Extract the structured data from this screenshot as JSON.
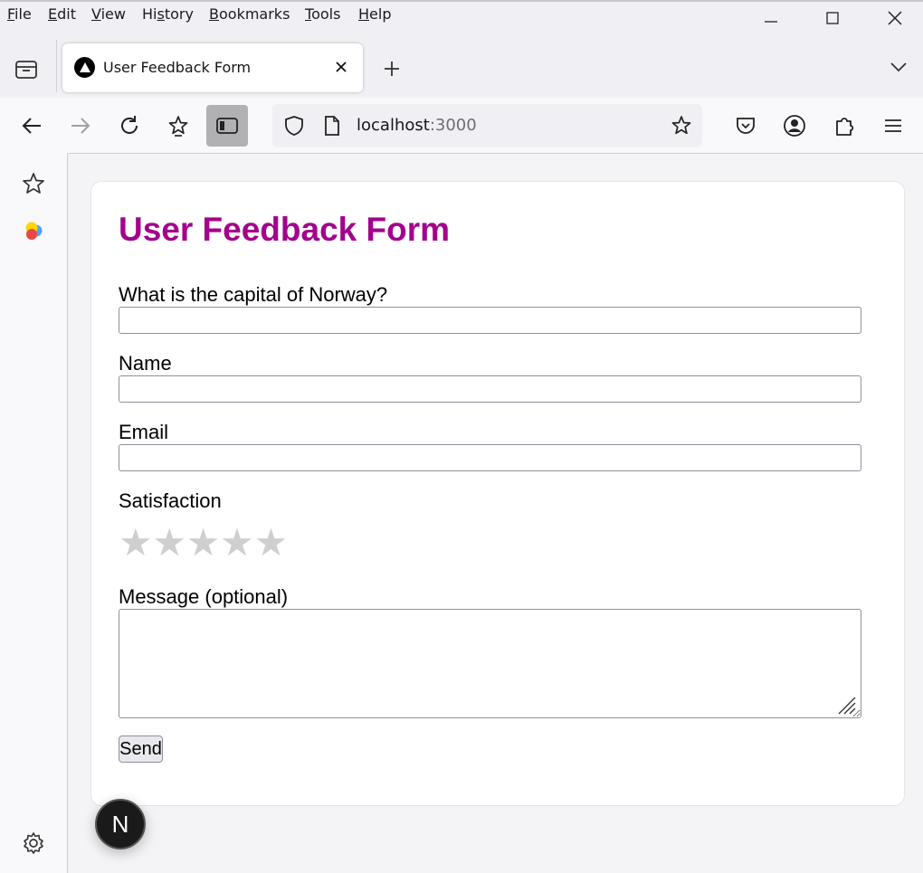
{
  "menu": {
    "file": {
      "accel": "F",
      "rest": "ile"
    },
    "edit": {
      "accel": "E",
      "rest": "dit"
    },
    "view": {
      "accel": "V",
      "rest": "iew"
    },
    "history": {
      "pre": "Hi",
      "accel": "s",
      "rest": "tory"
    },
    "bookmarks": {
      "accel": "B",
      "rest": "ookmarks"
    },
    "tools": {
      "accel": "T",
      "rest": "ools"
    },
    "help": {
      "accel": "H",
      "rest": "elp"
    }
  },
  "tab": {
    "title": "User Feedback Form"
  },
  "urlbar": {
    "host": "localhost",
    "port": ":3000"
  },
  "form": {
    "title": "User Feedback Form",
    "question_label": "What is the capital of Norway?",
    "question_value": "",
    "name_label": "Name",
    "name_value": "",
    "email_label": "Email",
    "email_value": "",
    "satisfaction_label": "Satisfaction",
    "satisfaction_rating": 0,
    "satisfaction_max": 5,
    "star_glyph": "★",
    "message_label": "Message (optional)",
    "message_value": "",
    "send_label": "Send"
  },
  "badge": {
    "letter": "N"
  },
  "colors": {
    "title": "#a3038c",
    "star_empty": "#cfcfcf",
    "accent_active": "#b1b1b4"
  }
}
